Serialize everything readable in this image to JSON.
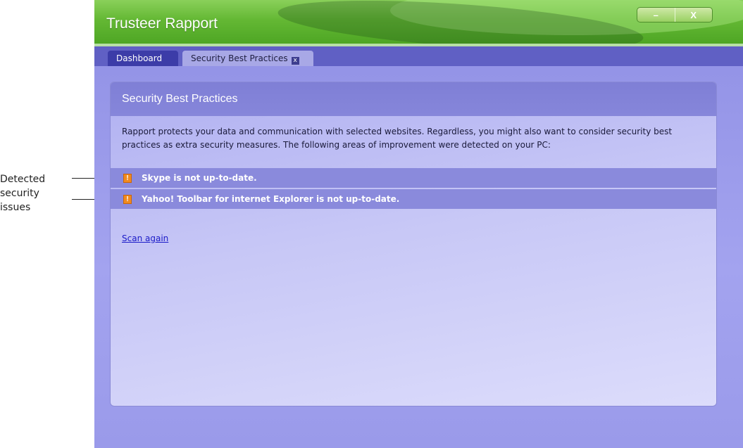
{
  "annotation": {
    "lines": [
      "Detected",
      "security",
      "issues"
    ]
  },
  "window": {
    "title": "Trusteer Rapport",
    "controls": {
      "minimize": "–",
      "close": "X"
    }
  },
  "tabs": [
    {
      "label": "Dashboard",
      "active": false
    },
    {
      "label": "Security Best Practices",
      "active": true,
      "close_label": "x"
    }
  ],
  "panel": {
    "title": "Security Best Practices",
    "description": "Rapport protects your data and communication with selected websites. Regardless, you might also want to consider security best practices as extra security measures. The following areas of improvement were detected on your PC:",
    "issues": [
      {
        "icon": "warning-icon",
        "icon_glyph": "!",
        "text": "Skype is not up-to-date."
      },
      {
        "icon": "warning-icon",
        "icon_glyph": "!",
        "text": "Yahoo! Toolbar for internet Explorer is not up-to-date."
      }
    ],
    "scan_again_label": "Scan again"
  },
  "colors": {
    "title_green": "#5cb42e",
    "tab_strip": "#6060c4",
    "panel_header": "#8282d8",
    "issue_row": "#8a8adc",
    "warning": "#f08a1e",
    "link": "#1a1ac8"
  }
}
